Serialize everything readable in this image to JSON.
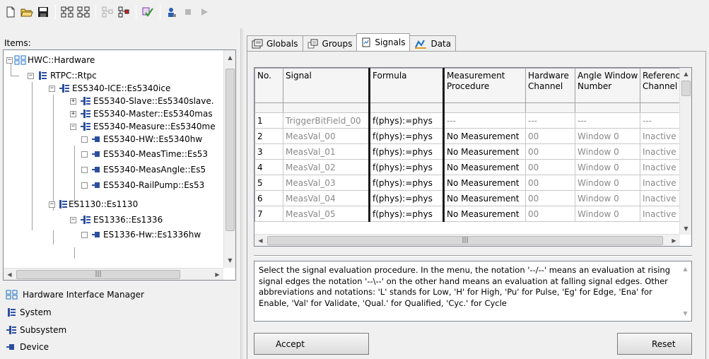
{
  "toolbar": {
    "icons": [
      "new-file-icon",
      "open-folder-icon",
      "save-icon",
      "hardware-tree-icon",
      "hardware-tree-2-icon",
      "tree-disabled-icon",
      "tree-add-icon",
      "check-icon",
      "user-icon",
      "stop-icon",
      "play-icon"
    ]
  },
  "left": {
    "items_label": "Items:",
    "tree": [
      {
        "label": "HWC::Hardware"
      },
      {
        "label": "RTPC::Rtpc"
      },
      {
        "label": "ES5340-ICE::Es5340ice"
      },
      {
        "label": "ES5340-Slave::Es5340slave."
      },
      {
        "label": "ES5340-Master::Es5340mas"
      },
      {
        "label": "ES5340-Measure::Es5340me"
      },
      {
        "label": "ES5340-HW::Es5340hw"
      },
      {
        "label": "ES5340-MeasTime::Es53"
      },
      {
        "label": "ES5340-MeasAngle::Es5"
      },
      {
        "label": "ES5340-RailPump::Es53"
      },
      {
        "label": "ES1130::Es1130"
      },
      {
        "label": "ES1336::Es1336"
      },
      {
        "label": "ES1336-Hw::Es1336hw"
      }
    ],
    "legend": [
      {
        "label": "Hardware Interface Manager",
        "icon": "hardware-interface-manager-icon"
      },
      {
        "label": "System",
        "icon": "system-icon"
      },
      {
        "label": "Subsystem",
        "icon": "subsystem-icon"
      },
      {
        "label": "Device",
        "icon": "device-icon"
      }
    ]
  },
  "tabs": [
    {
      "label": "Globals",
      "icon": "globals-icon"
    },
    {
      "label": "Groups",
      "icon": "groups-icon"
    },
    {
      "label": "Signals",
      "icon": "signals-icon"
    },
    {
      "label": "Data",
      "icon": "data-icon"
    }
  ],
  "grid": {
    "headers": [
      "No.",
      "Signal",
      "Formula",
      "Measurement Procedure",
      "Hardware Channel",
      "Angle Window Number",
      "Reference Channel"
    ],
    "rows": [
      [
        "1",
        "TriggerBitField_00",
        "f(phys):=phys",
        "---",
        "---",
        "---",
        "---"
      ],
      [
        "2",
        "MeasVal_00",
        "f(phys):=phys",
        "No Measurement",
        "00",
        "Window 0",
        "Inactive"
      ],
      [
        "3",
        "MeasVal_01",
        "f(phys):=phys",
        "No Measurement",
        "00",
        "Window 0",
        "Inactive"
      ],
      [
        "4",
        "MeasVal_02",
        "f(phys):=phys",
        "No Measurement",
        "00",
        "Window 0",
        "Inactive"
      ],
      [
        "5",
        "MeasVal_03",
        "f(phys):=phys",
        "No Measurement",
        "00",
        "Window 0",
        "Inactive"
      ],
      [
        "6",
        "MeasVal_04",
        "f(phys):=phys",
        "No Measurement",
        "00",
        "Window 0",
        "Inactive"
      ],
      [
        "7",
        "MeasVal_05",
        "f(phys):=phys",
        "No Measurement",
        "00",
        "Window 0",
        "Inactive"
      ]
    ]
  },
  "description": "Select the signal evaluation procedure. In the menu, the notation '--/--' means an evaluation at rising signal edges the notation '--\\--' on the other hand means an evaluation at falling signal edges. Other abbreviations and notations: 'L' stands for Low, 'H' for High, 'Pu' for Pulse, 'Eg' for Edge, 'Ena' for Enable, 'Val' for Validate, 'Qual.' for Qualified, 'Cyc.' for Cycle",
  "buttons": {
    "accept": "Accept",
    "reset": "Reset"
  },
  "colors": {
    "hw_icon": "#1a6fc4",
    "system_icon": "#2b4f9e",
    "tab_border": "#a0a0a0"
  }
}
